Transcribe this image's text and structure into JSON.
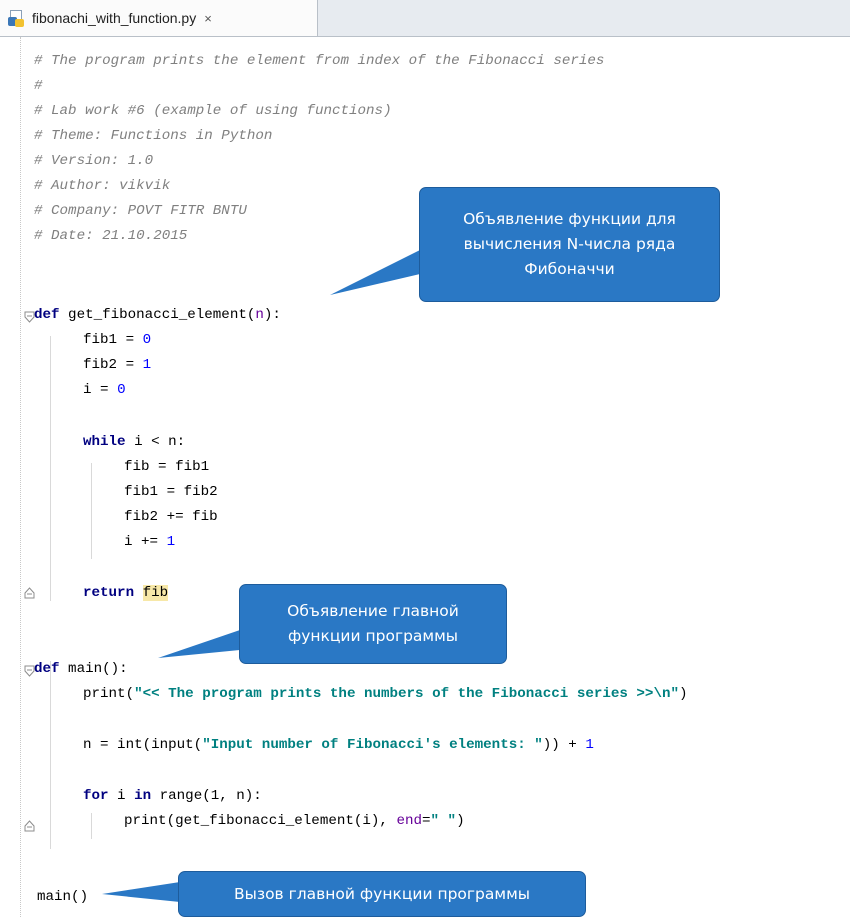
{
  "tab": {
    "filename": "fibonachi_with_function.py",
    "close_glyph": "×"
  },
  "code": {
    "l1": "# The program prints the element from index of the Fibonacci series",
    "l2": "#",
    "l3": "# Lab work #6 (example of using functions)",
    "l4": "# Theme: Functions in Python",
    "l5": "# Version: 1.0",
    "l6": "# Author: vikvik",
    "l7": "# Company: POVT FITR BNTU",
    "l8": "# Date: 21.10.2015",
    "kw_def": "def",
    "kw_while": "while",
    "kw_return": "return",
    "kw_for": "for",
    "kw_in": "in",
    "fn1_name": " get_fibonacci_element(",
    "fn1_param": "n",
    "fn1_close": "):",
    "fib1_lhs": "fib1 = ",
    "zero": "0",
    "fib2_lhs": "fib2 = ",
    "one": "1",
    "i_lhs": "i = ",
    "while_cond": " i < n:",
    "fib_assign": "fib = fib1",
    "fib1_assign": "fib1 = fib2",
    "fib2_aug": "fib2 += fib",
    "i_aug": "i += ",
    "return_val": "fib",
    "fn2_name": " main():",
    "print_open": "print(",
    "print_str": "\"<< The program prints the numbers of the Fibonacci series >>\\n\"",
    "close_paren": ")",
    "n_assign": "n = int(input(",
    "input_str": "\"Input number of Fibonacci's elements: \"",
    "n_tail": ")) + ",
    "for_mid": " i ",
    "for_range": " range(1, n):",
    "print2_open": "print(get_fibonacci_element(i), ",
    "end_kw": "end",
    "end_eq": "=",
    "end_str": "\" \"",
    "main_call": "main()"
  },
  "callouts": {
    "func_decl": "Объявление функции для вычисления N-числа ряда Фибоначчи",
    "main_decl": "Объявление главной функции программы",
    "main_call": "Вызов главной функции программы"
  },
  "colors": {
    "callout": "#2a78c5",
    "comment": "#808080",
    "keyword": "#000080",
    "number": "#0000ff",
    "string": "#008080"
  }
}
